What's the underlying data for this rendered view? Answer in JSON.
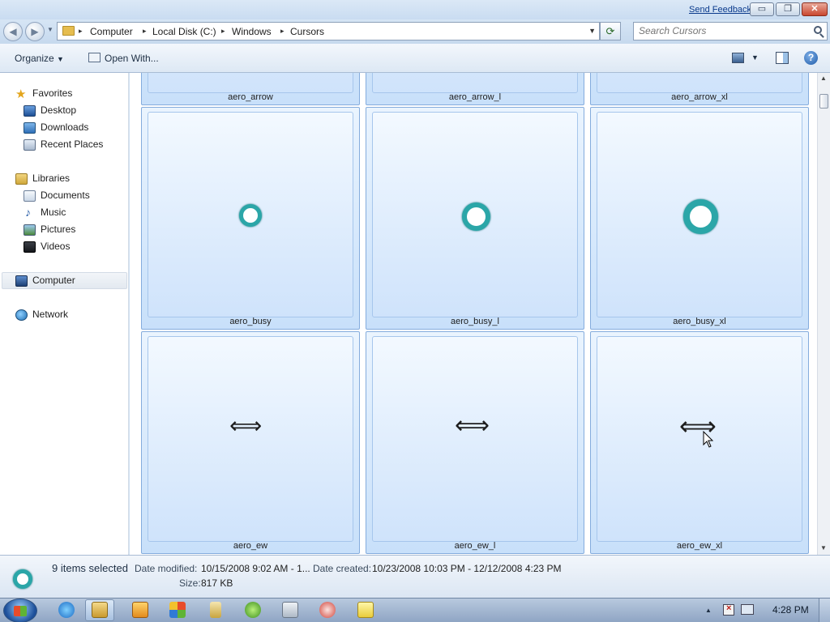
{
  "titlebar": {
    "feedback_link": "Send Feedback",
    "min_glyph": "▭",
    "max_glyph": "❐",
    "close_glyph": "✕"
  },
  "address": {
    "back_glyph": "◀",
    "forward_glyph": "▶",
    "dropdown_glyph": "▼",
    "refresh_glyph": "⟳",
    "crumb_sep": "▸",
    "crumbs": [
      "Computer",
      "Local Disk (C:)",
      "Windows",
      "Cursors"
    ]
  },
  "search": {
    "placeholder": "Search Cursors"
  },
  "toolbar": {
    "organize_label": "Organize",
    "organize_arrow": "▼",
    "open_with_label": "Open With...",
    "view_arrow": "▼",
    "help_glyph": "?"
  },
  "navpane": {
    "favorites": {
      "label": "Favorites",
      "items": [
        "Desktop",
        "Downloads",
        "Recent Places"
      ]
    },
    "libraries": {
      "label": "Libraries",
      "items": [
        "Documents",
        "Music",
        "Pictures",
        "Videos"
      ]
    },
    "computer": "Computer",
    "network": "Network"
  },
  "files": [
    {
      "name": "aero_arrow",
      "cursor": "arrow"
    },
    {
      "name": "aero_arrow_l",
      "cursor": "arrow"
    },
    {
      "name": "aero_arrow_xl",
      "cursor": "arrow"
    },
    {
      "name": "aero_busy",
      "cursor": "busy-ring"
    },
    {
      "name": "aero_busy_l",
      "cursor": "busy-ring"
    },
    {
      "name": "aero_busy_xl",
      "cursor": "busy-ring"
    },
    {
      "name": "aero_ew",
      "cursor": "ew-resize"
    },
    {
      "name": "aero_ew_l",
      "cursor": "ew-resize"
    },
    {
      "name": "aero_ew_xl",
      "cursor": "ew-resize"
    }
  ],
  "glyphs": {
    "ew_glyph": "⟺",
    "scroll_up": "▲",
    "scroll_down": "▼"
  },
  "details": {
    "selection": "9 items selected",
    "modified_label": "Date modified:",
    "modified_value": "10/15/2008 9:02 AM - 1...",
    "created_label": "Date created:",
    "created_value": "10/23/2008 10:03 PM - 12/12/2008 4:23 PM",
    "size_label": "Size:",
    "size_value": "817 KB"
  },
  "taskbar": {
    "clock": "4:28 PM",
    "tray_up_glyph": "▲",
    "pinned": [
      "internet-explorer-icon",
      "windows-explorer-icon",
      "media-player-icon",
      "paint-icon",
      "tools-icon",
      "xbox-icon",
      "calculator-icon",
      "snipping-icon",
      "sticky-notes-icon"
    ]
  },
  "colors": {
    "accent": "#3a7bd5",
    "tile_border": "#84acdd",
    "busy_ring": "#2ba6a8"
  }
}
